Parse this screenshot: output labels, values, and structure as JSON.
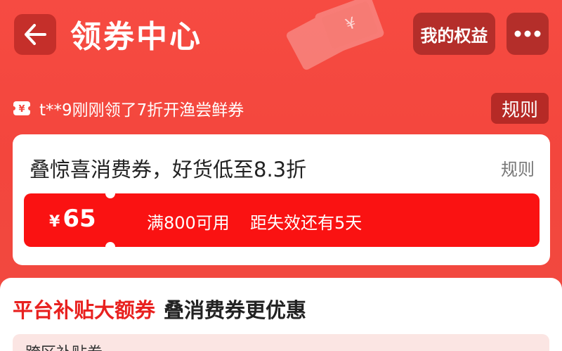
{
  "header": {
    "title": "领券中心",
    "benefits_label": "我的权益",
    "icons": {
      "back": "back-arrow-icon",
      "more": "more-dots-icon",
      "decor": "coupon-ticket-icon"
    }
  },
  "ticker": {
    "icon": "yen-ticket-icon",
    "text": "t**9刚刚领了7折开渔尝鲜券",
    "rule_label": "规则"
  },
  "promo_card": {
    "title": "叠惊喜消费券，好货低至8.3折",
    "rule_label": "规则",
    "coupon": {
      "currency": "¥",
      "amount": "65",
      "condition": "满800可用",
      "expiry": "距失效还有5天"
    }
  },
  "subsidy_section": {
    "title_accent": "平台补贴大额券",
    "title_rest": "叠消费券更优惠",
    "first_row_text": "跨区补贴券"
  },
  "colors": {
    "background": "#f4473e",
    "coupon": "#fa1212",
    "accent_text": "#e8211f",
    "dark_button": "#b42e2a"
  }
}
